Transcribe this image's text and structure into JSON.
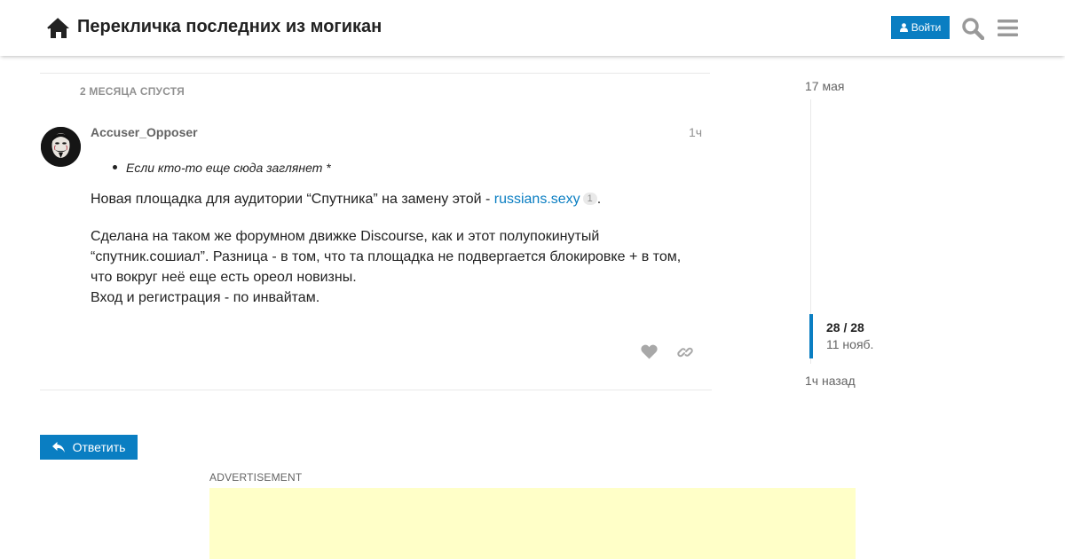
{
  "header": {
    "title": "Перекличка последних из могикан",
    "login_label": "Войти",
    "accent_color": "#0a7ec2",
    "icons": [
      "home-icon",
      "user-icon",
      "search-icon",
      "hamburger-menu-icon"
    ]
  },
  "post": {
    "time_gap": "2 МЕСЯЦА СПУСТЯ",
    "username": "Accuser_Opposer",
    "date": "1ч",
    "quote_item": "Если кто-то еще сюда заглянет *",
    "para1_prefix": "Новая площадка для аудитории “Спутника” на замену этой - ",
    "para1_link": "russians.sexy",
    "para1_link_clicks": "1",
    "para1_suffix": ".",
    "para2_lines": [
      "Сделана на таком же форумном движке Discourse, как и этот полупокинутый",
      "“спутник.сошиал”. Разница - в том, что та площадка не подвергается блокировке + в том,",
      "что вокруг неё еще есть ореол новизны.",
      "Вход и регистрация - по инвайтам."
    ],
    "action_icons": [
      "heart-icon",
      "link-icon"
    ]
  },
  "reply": {
    "label": "Ответить",
    "icon": "reply-icon"
  },
  "advertisement": {
    "label": "ADVERTISEMENT",
    "background_color": "#ffffc8"
  },
  "timeline": {
    "start_label": "17 мая",
    "position": "28 / 28",
    "position_date": "11 нояб.",
    "end_label": "1ч назад"
  }
}
